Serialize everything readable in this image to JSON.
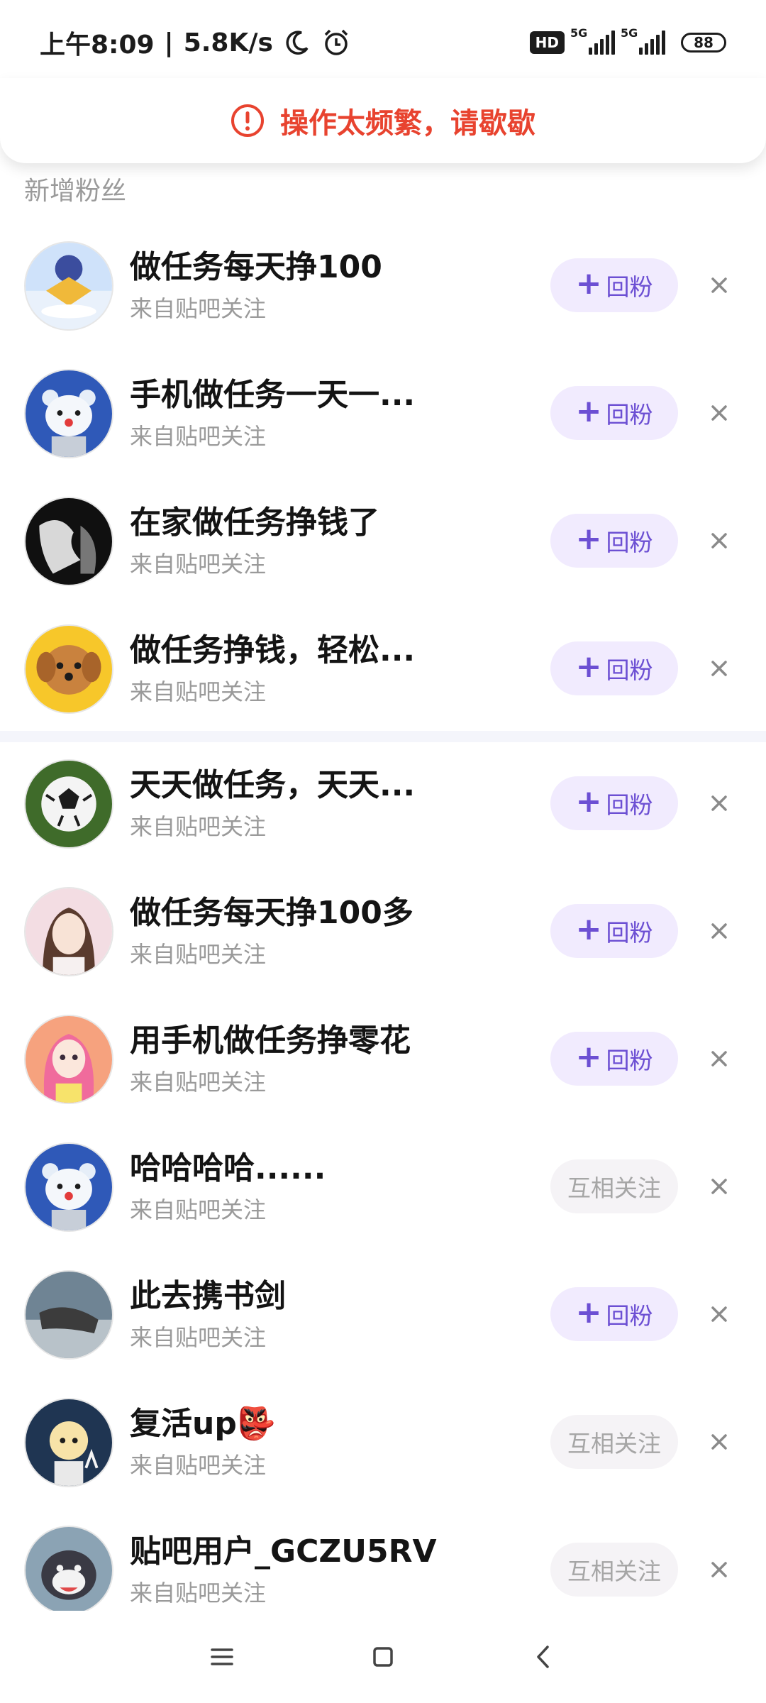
{
  "status_bar": {
    "time": "上午8:09",
    "separator": "|",
    "speed": "5.8K/s",
    "hd_label": "HD",
    "network_1": "5G",
    "network_2": "5G",
    "battery": "88",
    "icons": [
      "moon-icon",
      "alarm-icon",
      "signal-icon",
      "battery-icon"
    ]
  },
  "toast": {
    "message": "操作太频繁，请歇歇",
    "icon": "warning-icon",
    "color": "#e8432f"
  },
  "section": {
    "title": "新增粉丝"
  },
  "colors": {
    "accent": "#6c4fd3",
    "follow_bg": "#f1ebfe",
    "mutual_bg": "#f5f3f6",
    "muted": "#9a9a9a"
  },
  "followers": [
    {
      "name": "做任务每天挣100",
      "source": "来自贴吧关注",
      "action": "回粉",
      "state": "follow"
    },
    {
      "name": "手机做任务一天一...",
      "source": "来自贴吧关注",
      "action": "回粉",
      "state": "follow"
    },
    {
      "name": "在家做任务挣钱了",
      "source": "来自贴吧关注",
      "action": "回粉",
      "state": "follow"
    },
    {
      "name": "做任务挣钱，轻松...",
      "source": "来自贴吧关注",
      "action": "回粉",
      "state": "follow"
    },
    {
      "name": "天天做任务，天天...",
      "source": "来自贴吧关注",
      "action": "回粉",
      "state": "follow"
    },
    {
      "name": "做任务每天挣100多",
      "source": "来自贴吧关注",
      "action": "回粉",
      "state": "follow"
    },
    {
      "name": "用手机做任务挣零花",
      "source": "来自贴吧关注",
      "action": "回粉",
      "state": "follow"
    },
    {
      "name": "哈哈哈哈......",
      "source": "来自贴吧关注",
      "action": "互相关注",
      "state": "mutual"
    },
    {
      "name": "此去携书剑",
      "source": "来自贴吧关注",
      "action": "回粉",
      "state": "follow"
    },
    {
      "name": "复活up👺",
      "source": "来自贴吧关注",
      "action": "互相关注",
      "state": "mutual"
    },
    {
      "name": "贴吧用户_GCZU5RV",
      "source": "来自贴吧关注",
      "action": "互相关注",
      "state": "mutual"
    }
  ],
  "nav_bar": {
    "icons": [
      "menu-icon",
      "home-square-icon",
      "back-chevron-icon"
    ]
  }
}
